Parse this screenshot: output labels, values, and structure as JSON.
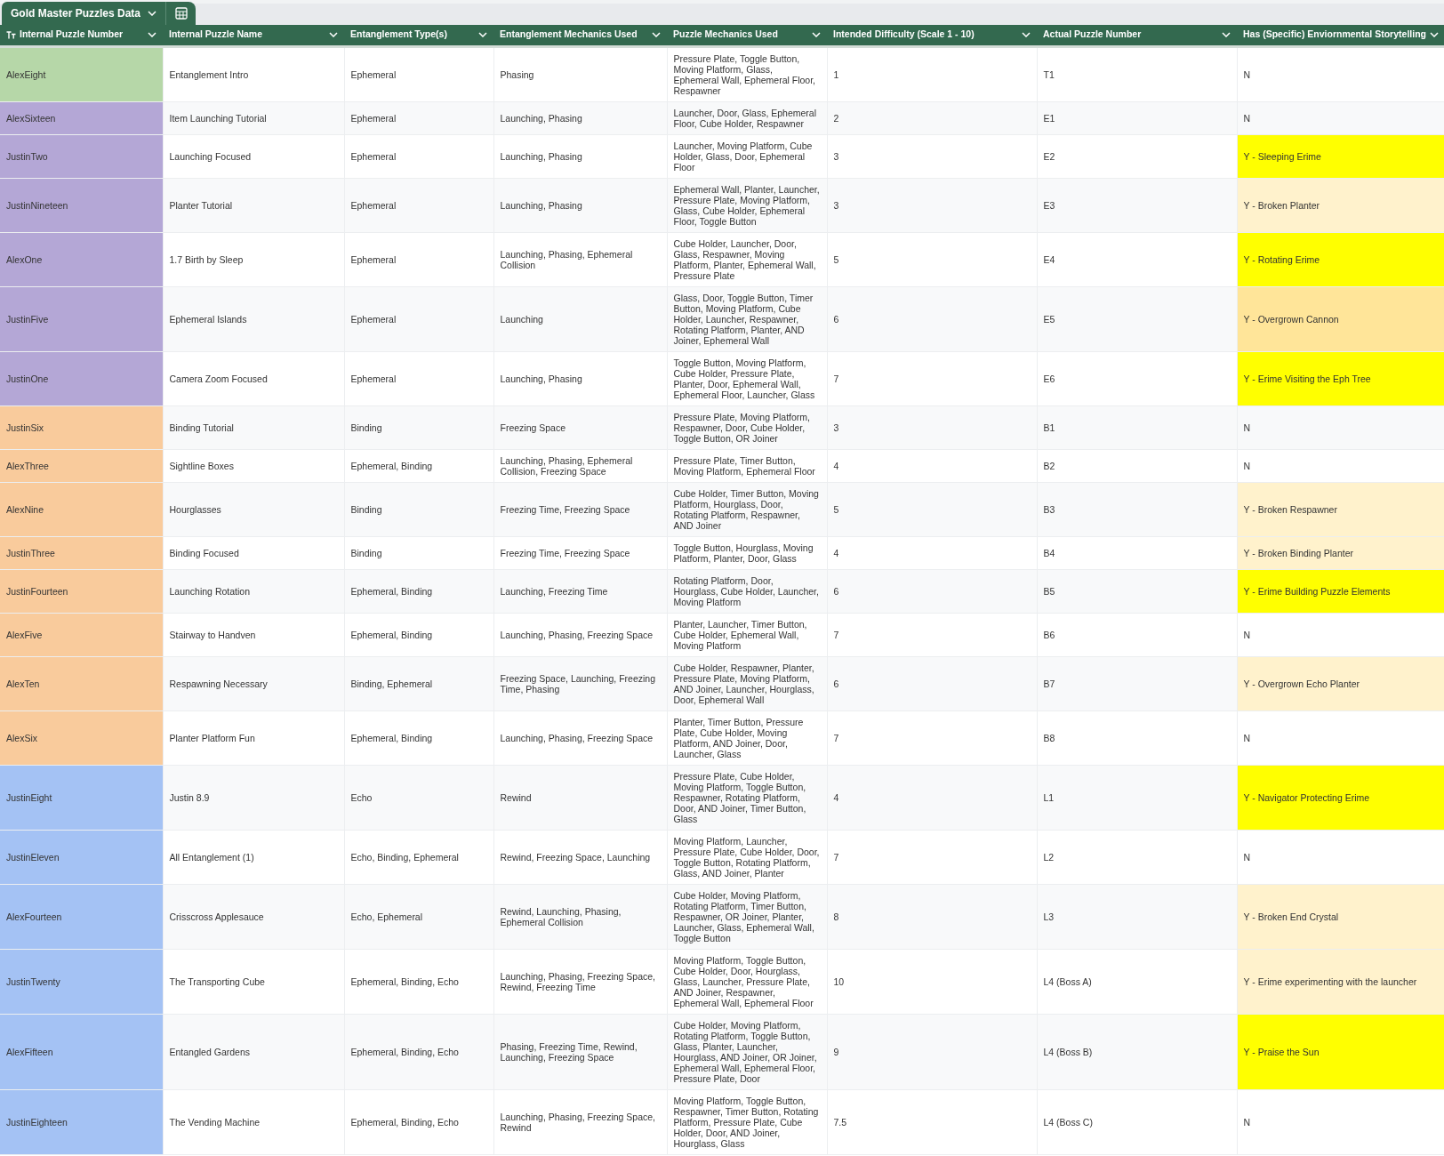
{
  "sheet_tabs": [
    {
      "label": "Gold Master Puzzles Data",
      "selected": true
    }
  ],
  "table": {
    "columns": [
      "Internal Puzzle Number",
      "Internal Puzzle Name",
      "Entanglement Type(s)",
      "Entanglement Mechanics Used",
      "Puzzle Mechanics Used",
      "Intended Difficulty (Scale 1 - 10)",
      "Actual Puzzle Number",
      "Has (Specific) Enviornmental Storytelling"
    ],
    "rows": [
      {
        "color": "#b6d7a8",
        "cells": [
          "AlexEight",
          "Entanglement Intro",
          "Ephemeral",
          "Phasing",
          "Pressure Plate, Toggle Button, Moving Platform, Glass, Ephemeral Wall, Ephemeral Floor, Respawner",
          "1",
          "T1"
        ],
        "storytelling": {
          "text": "N"
        }
      },
      {
        "color": "#b4a7d6",
        "cells": [
          "AlexSixteen",
          "Item Launching Tutorial",
          "Ephemeral",
          "Launching, Phasing",
          "Launcher, Door, Glass, Ephemeral Floor, Cube Holder, Respawner",
          "2",
          "E1"
        ],
        "storytelling": {
          "text": "N"
        }
      },
      {
        "color": "#b4a7d6",
        "cells": [
          "JustinTwo",
          "Launching Focused",
          "Ephemeral",
          "Launching, Phasing",
          "Launcher, Moving Platform, Cube Holder, Glass, Door, Ephemeral Floor",
          "3",
          "E2"
        ],
        "storytelling": {
          "text": "Y - Sleeping Erime",
          "color": "#ffff00"
        }
      },
      {
        "color": "#b4a7d6",
        "cells": [
          "JustinNineteen",
          "Planter Tutorial",
          "Ephemeral",
          "Launching, Phasing",
          "Ephemeral Wall, Planter, Launcher, Pressure Plate, Moving Platform, Glass, Cube Holder, Ephemeral Floor, Toggle Button",
          "3",
          "E3"
        ],
        "storytelling": {
          "text": "Y - Broken Planter",
          "color": "#fff2cc"
        }
      },
      {
        "color": "#b4a7d6",
        "cells": [
          "AlexOne",
          "1.7 Birth by Sleep",
          "Ephemeral",
          "Launching, Phasing, Ephemeral Collision",
          "Cube Holder, Launcher, Door, Glass, Respawner, Moving Platform, Planter, Ephemeral Wall, Pressure Plate",
          "5",
          "E4"
        ],
        "storytelling": {
          "text": "Y - Rotating Erime",
          "color": "#ffff00"
        }
      },
      {
        "color": "#b4a7d6",
        "cells": [
          "JustinFive",
          "Ephemeral Islands",
          "Ephemeral",
          "Launching",
          "Glass, Door, Toggle Button, Timer Button, Moving Platform, Cube Holder, Launcher, Respawner, Rotating Platform, Planter, AND Joiner, Ephemeral Wall",
          "6",
          "E5"
        ],
        "storytelling": {
          "text": "Y - Overgrown Cannon",
          "color": "#ffe599"
        }
      },
      {
        "color": "#b4a7d6",
        "cells": [
          "JustinOne",
          "Camera Zoom Focused",
          "Ephemeral",
          "Launching, Phasing",
          "Toggle Button, Moving Platform, Cube Holder, Pressure Plate, Planter, Door, Ephemeral Wall, Ephemeral Floor, Launcher, Glass",
          "7",
          "E6"
        ],
        "storytelling": {
          "text": "Y - Erime Visiting the Eph Tree",
          "color": "#ffff00"
        }
      },
      {
        "color": "#f9cb9c",
        "cells": [
          "JustinSix",
          "Binding Tutorial",
          "Binding",
          "Freezing Space",
          "Pressure Plate, Moving Platform, Respawner, Door, Cube Holder, Toggle Button, OR Joiner",
          "3",
          "B1"
        ],
        "storytelling": {
          "text": "N"
        }
      },
      {
        "color": "#f9cb9c",
        "cells": [
          "AlexThree",
          "Sightline Boxes",
          "Ephemeral, Binding",
          "Launching, Phasing, Ephemeral Collision, Freezing Space",
          "Pressure Plate, Timer Button, Moving Platform, Ephemeral Floor",
          "4",
          "B2"
        ],
        "storytelling": {
          "text": "N"
        }
      },
      {
        "color": "#f9cb9c",
        "cells": [
          "AlexNine",
          "Hourglasses",
          "Binding",
          "Freezing Time, Freezing Space",
          "Cube Holder, Timer Button, Moving Platform, Hourglass, Door, Rotating Platform, Respawner, AND Joiner",
          "5",
          "B3"
        ],
        "storytelling": {
          "text": "Y - Broken Respawner",
          "color": "#fff2cc"
        }
      },
      {
        "color": "#f9cb9c",
        "cells": [
          "JustinThree",
          "Binding Focused",
          "Binding",
          "Freezing Time, Freezing Space",
          "Toggle Button, Hourglass, Moving Platform, Planter, Door, Glass",
          "4",
          "B4"
        ],
        "storytelling": {
          "text": "Y - Broken Binding Planter",
          "color": "#fff2cc"
        }
      },
      {
        "color": "#f9cb9c",
        "cells": [
          "JustinFourteen",
          "Launching Rotation",
          "Ephemeral, Binding",
          "Launching, Freezing Time",
          "Rotating Platform, Door, Hourglass, Cube Holder, Launcher, Moving Platform",
          "6",
          "B5"
        ],
        "storytelling": {
          "text": "Y - Erime Building Puzzle Elements",
          "color": "#ffff00"
        }
      },
      {
        "color": "#f9cb9c",
        "cells": [
          "AlexFive",
          "Stairway to Handven",
          "Ephemeral, Binding",
          "Launching, Phasing, Freezing Space",
          "Planter, Launcher, Timer Button, Cube Holder, Ephemeral Wall, Moving Platform",
          "7",
          "B6"
        ],
        "storytelling": {
          "text": "N"
        }
      },
      {
        "color": "#f9cb9c",
        "cells": [
          "AlexTen",
          "Respawning Necessary",
          "Binding, Ephemeral",
          "Freezing Space, Launching, Freezing Time, Phasing",
          "Cube Holder, Respawner, Planter, Pressure Plate, Moving Platform, AND Joiner, Launcher, Hourglass, Door, Ephemeral Wall",
          "6",
          "B7"
        ],
        "storytelling": {
          "text": "Y - Overgrown Echo Planter",
          "color": "#fff2cc"
        }
      },
      {
        "color": "#f9cb9c",
        "cells": [
          "AlexSix",
          "Planter Platform Fun",
          "Ephemeral, Binding",
          "Launching, Phasing, Freezing Space",
          "Planter, Timer Button, Pressure Plate, Cube Holder, Moving Platform, AND Joiner, Door, Launcher, Glass",
          "7",
          "B8"
        ],
        "storytelling": {
          "text": "N"
        }
      },
      {
        "color": "#a4c2f4",
        "cells": [
          "JustinEight",
          "Justin 8.9",
          "Echo",
          "Rewind",
          "Pressure Plate, Cube Holder, Moving Platform, Toggle Button, Respawner, Rotating Platform, Door, AND Joiner, Timer Button, Glass",
          "4",
          "L1"
        ],
        "storytelling": {
          "text": "Y - Navigator Protecting Erime",
          "color": "#ffff00"
        }
      },
      {
        "color": "#a4c2f4",
        "cells": [
          "JustinEleven",
          "All Entanglement (1)",
          "Echo, Binding, Ephemeral",
          "Rewind, Freezing Space, Launching",
          "Moving Platform, Launcher, Pressure Plate, Cube Holder, Door, Toggle Button, Rotating Platform, Glass, AND Joiner, Planter",
          "7",
          "L2"
        ],
        "storytelling": {
          "text": "N"
        }
      },
      {
        "color": "#a4c2f4",
        "cells": [
          "AlexFourteen",
          "Crisscross Applesauce",
          "Echo, Ephemeral",
          "Rewind, Launching, Phasing, Ephemeral Collision",
          "Cube Holder, Moving Platform, Rotating Platform, Timer Button, Respawner, OR Joiner, Planter, Launcher, Glass, Ephemeral Wall, Toggle Button",
          "8",
          "L3"
        ],
        "storytelling": {
          "text": "Y - Broken End Crystal",
          "color": "#fff2cc"
        }
      },
      {
        "color": "#a4c2f4",
        "cells": [
          "JustinTwenty",
          "The Transporting Cube",
          "Ephemeral, Binding, Echo",
          "Launching, Phasing, Freezing Space, Rewind, Freezing Time",
          "Moving Platform, Toggle Button, Cube Holder, Door, Hourglass, Glass, Launcher, Pressure Plate, AND Joiner, Respawner, Ephemeral Wall, Ephemeral Floor",
          "10",
          "L4 (Boss A)"
        ],
        "storytelling": {
          "text": "Y - Erime experimenting with the launcher",
          "color": "#fff2cc"
        }
      },
      {
        "color": "#a4c2f4",
        "cells": [
          "AlexFifteen",
          "Entangled Gardens",
          "Ephemeral, Binding, Echo",
          "Phasing, Freezing Time, Rewind, Launching, Freezing Space",
          "Cube Holder, Moving Platform, Rotating Platform, Toggle Button, Glass, Planter, Launcher, Hourglass, AND Joiner, OR Joiner, Ephemeral Wall, Ephemeral Floor, Pressure Plate, Door",
          "9",
          "L4 (Boss B)"
        ],
        "storytelling": {
          "text": "Y - Praise the Sun",
          "color": "#ffff00"
        }
      },
      {
        "color": "#a4c2f4",
        "cells": [
          "JustinEighteen",
          "The Vending Machine",
          "Ephemeral, Binding, Echo",
          "Launching, Phasing, Freezing Space, Rewind",
          "Moving Platform, Toggle Button, Respawner, Timer Button, Rotating Platform, Pressure Plate, Cube Holder, Door, AND Joiner, Hourglass, Glass",
          "7.5",
          "L4 (Boss C)"
        ],
        "storytelling": {
          "text": "N"
        }
      }
    ]
  }
}
